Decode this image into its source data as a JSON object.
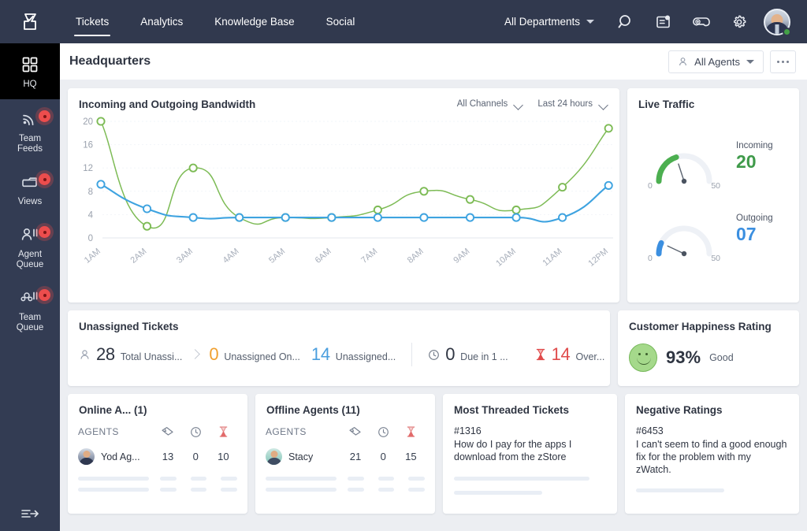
{
  "topnav": {
    "brand_icon": "zoho-desk-logo-icon",
    "tabs": [
      {
        "label": "Tickets",
        "active": true
      },
      {
        "label": "Analytics",
        "active": false
      },
      {
        "label": "Knowledge Base",
        "active": false
      },
      {
        "label": "Social",
        "active": false
      }
    ],
    "department_selector": "All Departments",
    "icons": [
      "search-icon",
      "notes-icon",
      "gamification-icon",
      "gear-icon"
    ],
    "avatar_status": "online"
  },
  "sidebar": {
    "items": [
      {
        "label": "HQ",
        "icon": "grid-icon",
        "active": true,
        "badge": false
      },
      {
        "label": "Team\nFeeds",
        "label_line1": "Team",
        "label_line2": "Feeds",
        "icon": "feed-icon",
        "active": false,
        "badge": true
      },
      {
        "label": "Views",
        "label_line1": "Views",
        "label_line2": "",
        "icon": "folder-icon",
        "active": false,
        "badge": true
      },
      {
        "label": "Agent Queue",
        "label_line1": "Agent",
        "label_line2": "Queue",
        "icon": "agent-queue-icon",
        "active": false,
        "badge": true
      },
      {
        "label": "Team Queue",
        "label_line1": "Team",
        "label_line2": "Queue",
        "icon": "team-queue-icon",
        "active": false,
        "badge": true
      }
    ],
    "collapse_icon": "collapse-sidebar-icon"
  },
  "header": {
    "title": "Headquarters",
    "agents_filter": "All Agents",
    "agents_filter_icon": "person-icon",
    "more_icon": "more-options-icon"
  },
  "chart_card": {
    "title": "Incoming and Outgoing Bandwidth",
    "filters": [
      {
        "label": "All Channels",
        "icon": "chevron-down-icon"
      },
      {
        "label": "Last 24 hours",
        "icon": "chevron-down-icon"
      }
    ]
  },
  "chart_data": {
    "type": "line",
    "title": "Incoming and Outgoing Bandwidth",
    "xlabel": "",
    "ylabel": "",
    "categories": [
      "1AM",
      "2AM",
      "3AM",
      "4AM",
      "5AM",
      "6AM",
      "7AM",
      "8AM",
      "9AM",
      "10AM",
      "11AM",
      "12PM"
    ],
    "ylim": [
      0,
      20
    ],
    "yticks": [
      0,
      4,
      8,
      12,
      16,
      20
    ],
    "grid": true,
    "legend": "none",
    "series": [
      {
        "name": "Incoming",
        "color": "#7dbb55",
        "values": [
          20,
          2.0,
          12,
          3.5,
          3.5,
          3.5,
          4.8,
          8.0,
          6.6,
          4.8,
          8.7,
          18.8
        ]
      },
      {
        "name": "Outgoing",
        "color": "#3ea3e0",
        "values": [
          9.2,
          5.0,
          3.5,
          3.5,
          3.5,
          3.5,
          3.5,
          3.5,
          3.5,
          3.5,
          3.5,
          9.0
        ]
      }
    ]
  },
  "live_traffic": {
    "title": "Live Traffic",
    "gauges": [
      {
        "label": "Incoming",
        "value": "20",
        "numeric": 20,
        "min": "0",
        "max": "50",
        "color": "#4caf50"
      },
      {
        "label": "Outgoing",
        "value": "07",
        "numeric": 7,
        "min": "0",
        "max": "50",
        "color": "#3b8fe0"
      }
    ]
  },
  "unassigned": {
    "title": "Unassigned Tickets",
    "stats": [
      {
        "icon": "person-outline-icon",
        "value": "28",
        "label": "Total Unassi...",
        "color": "#2f3542"
      },
      {
        "icon": "",
        "value": "0",
        "label": "Unassigned On...",
        "color": "#f0a030"
      },
      {
        "icon": "",
        "value": "14",
        "label": "Unassigned...",
        "color": "#4a9ede"
      },
      {
        "icon": "clock-icon",
        "value": "0",
        "label": "Due in 1 ...",
        "color": "#2f3542"
      },
      {
        "icon": "hourglass-icon",
        "value": "14",
        "label": "Over...",
        "color": "#e04b4b"
      }
    ]
  },
  "happiness": {
    "title": "Customer Happiness Rating",
    "percent": "93%",
    "rating_label": "Good",
    "face_icon": "smiley-face-icon"
  },
  "online_agents": {
    "title": "Online A... (1)",
    "columns": [
      "AGENTS",
      "ticket-icon",
      "clock-icon",
      "hourglass-icon"
    ],
    "rows": [
      {
        "name": "Yod Ag...",
        "tickets": "13",
        "time": "0",
        "overdue": "10",
        "avatar": "m"
      }
    ]
  },
  "offline_agents": {
    "title": "Offline Agents (11)",
    "columns": [
      "AGENTS",
      "ticket-icon",
      "clock-icon",
      "hourglass-icon"
    ],
    "rows": [
      {
        "name": "Stacy",
        "tickets": "21",
        "time": "0",
        "overdue": "15",
        "avatar": "f"
      }
    ]
  },
  "most_threaded": {
    "title": "Most Threaded Tickets",
    "ticket_id": "#1316",
    "subject": "How do I pay for the apps I download from the zStore"
  },
  "negative_ratings": {
    "title": "Negative Ratings",
    "ticket_id": "#6453",
    "subject": "I can't seem to find a good enough fix for the problem with my zWatch."
  }
}
